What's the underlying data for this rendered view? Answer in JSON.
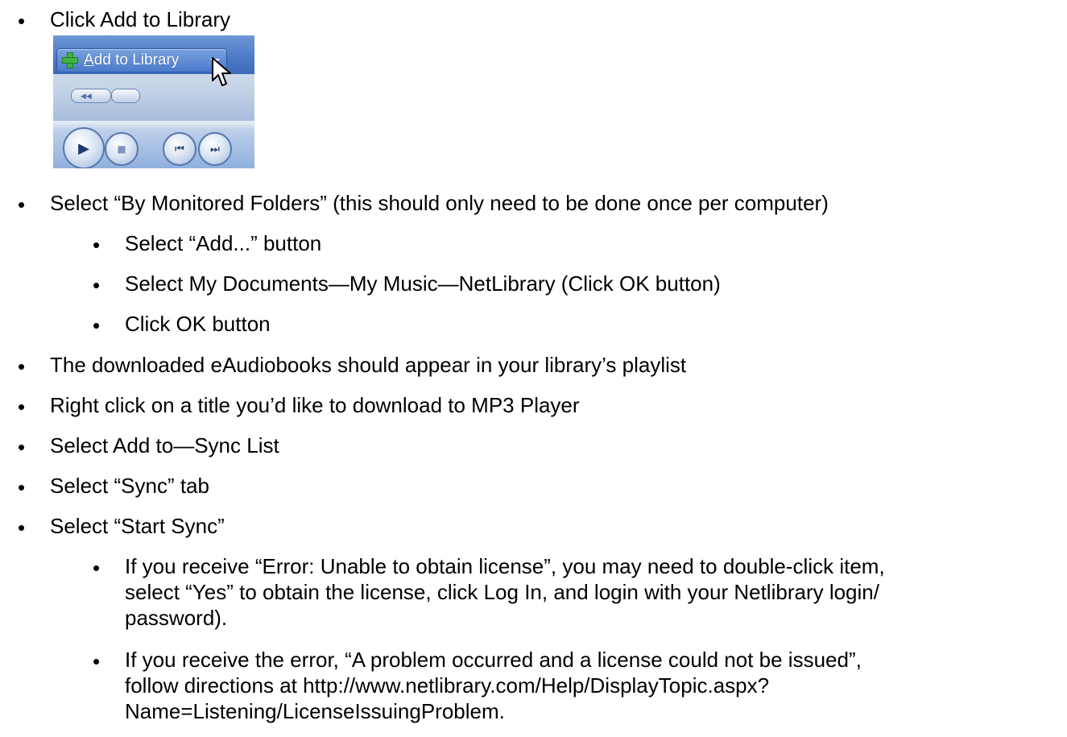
{
  "screenshot": {
    "add_button_mnemonic": "A",
    "add_button_rest": "dd to Library",
    "play_glyph": "▶",
    "stop_glyph": "■",
    "prev_glyph": "⏮",
    "next_glyph": "⏭",
    "seek_glyph": "◀◀",
    "colors": {
      "toolbar_blue": "#4a79c7",
      "plus_green": "#3fb33f"
    }
  },
  "bullet_glyph": "•",
  "items": {
    "i0": "Click Add to Library",
    "i1": "Select “By Monitored Folders” (this should only need to be done once per computer)",
    "i1a": "Select “Add...” button",
    "i1b": "Select My Documents—My Music—NetLibrary (Click OK button)",
    "i1c": "Click OK button",
    "i2": "The downloaded eAudiobooks should appear in your library’s playlist",
    "i3": "Right click on a title you’d like to download to MP3 Player",
    "i4": "Select Add to—Sync List",
    "i5": "Select “Sync” tab",
    "i6": "Select “Start Sync”",
    "i6a_l1": "If you receive “Error: Unable to obtain license”, you may need to double-click item,",
    "i6a_l2": "select “Yes” to obtain the license, click Log In, and login with your Netlibrary login/",
    "i6a_l3": "password).",
    "i6b_l1": "If you receive the error, “A problem occurred and a license could not be issued”,",
    "i6b_l2": "follow directions at http://www.netlibrary.com/Help/DisplayTopic.aspx?",
    "i6b_l3": "Name=Listening/LicenseIssuingProblem."
  }
}
